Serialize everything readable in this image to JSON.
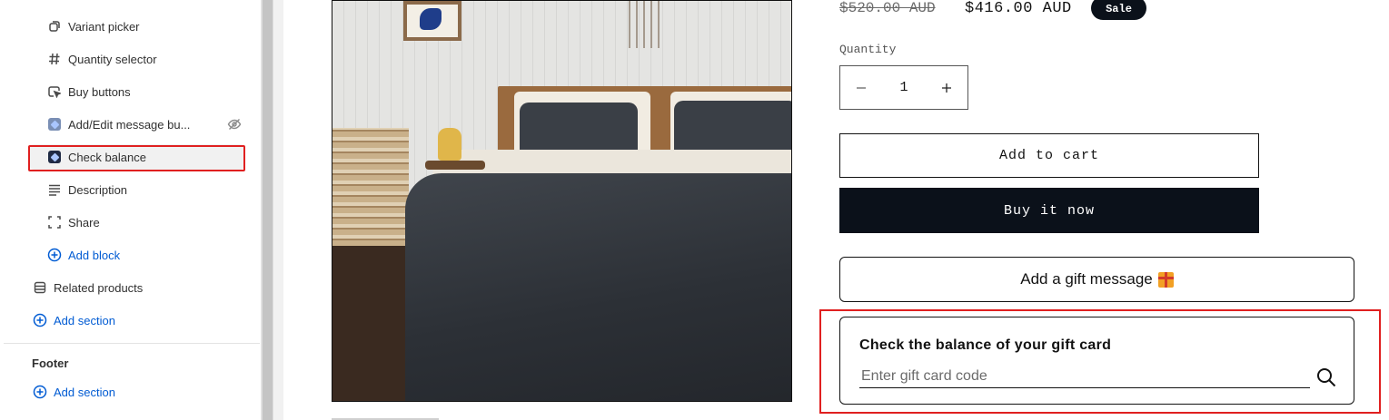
{
  "sidebar": {
    "items": [
      {
        "label": "Variant picker",
        "icon": "variant-picker-icon"
      },
      {
        "label": "Quantity selector",
        "icon": "hash-icon"
      },
      {
        "label": "Buy buttons",
        "icon": "cursor-click-icon"
      },
      {
        "label": "Add/Edit message bu...",
        "icon": "app-block-icon",
        "hidden": true
      },
      {
        "label": "Check balance",
        "icon": "app-block-icon",
        "selected": true
      },
      {
        "label": "Description",
        "icon": "text-align-icon"
      },
      {
        "label": "Share",
        "icon": "share-frame-icon"
      },
      {
        "label": "Add block",
        "icon": "plus-circle-icon"
      }
    ],
    "section_related": "Related products",
    "add_section": "Add section",
    "footer_heading": "Footer",
    "footer_add_section": "Add section"
  },
  "product": {
    "price_compare": "$520.00 AUD",
    "price_sale": "$416.00 AUD",
    "sale_badge": "Sale",
    "quantity_label": "Quantity",
    "quantity_value": "1",
    "add_to_cart": "Add to cart",
    "buy_now": "Buy it now",
    "gift_message": "Add a gift message"
  },
  "gift_card_balance": {
    "title": "Check the balance of your gift card",
    "placeholder": "Enter gift card code"
  },
  "colors": {
    "accent_blue": "#005bd3",
    "highlight_red": "#e02020",
    "button_dark": "#0b111a"
  }
}
